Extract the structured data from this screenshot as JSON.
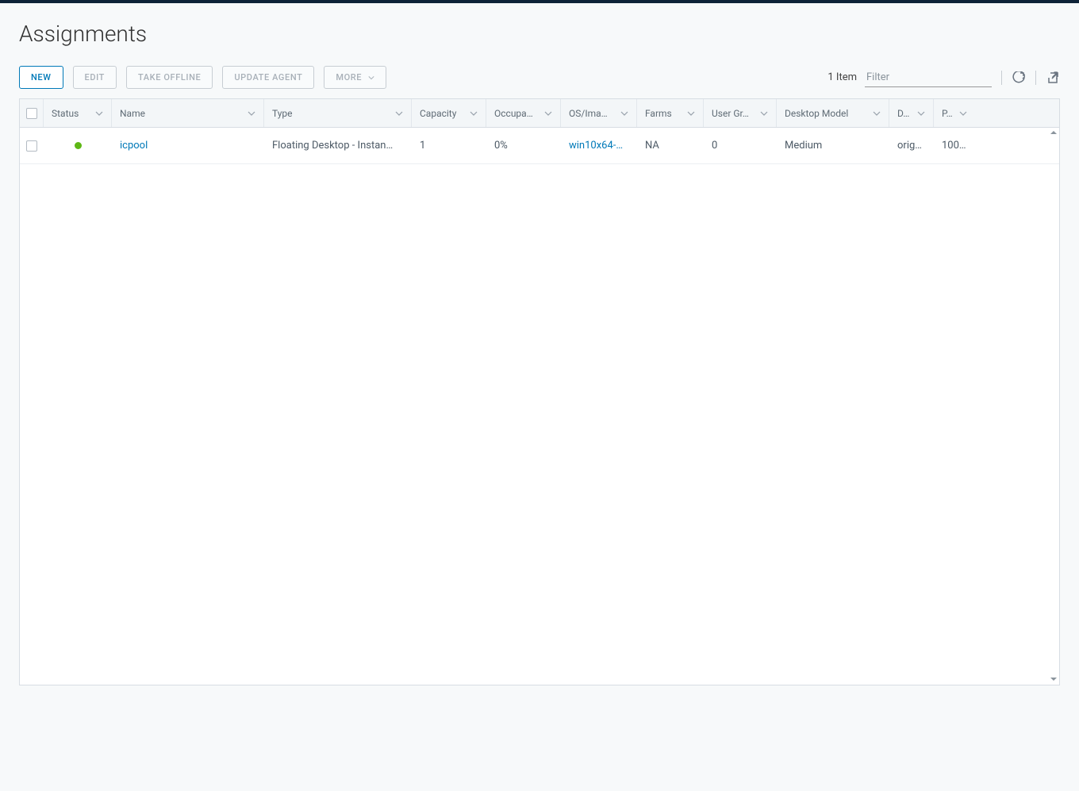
{
  "page": {
    "title": "Assignments"
  },
  "toolbar": {
    "new": "New",
    "edit": "Edit",
    "take_offline": "Take Offline",
    "update_agent": "Update Agent",
    "more": "More",
    "item_count": "1 Item",
    "filter_placeholder": "Filter"
  },
  "columns": {
    "status": "Status",
    "name": "Name",
    "type": "Type",
    "capacity": "Capacity",
    "occupancy": "Occupa…",
    "osimage": "OS/Ima…",
    "farms": "Farms",
    "usergroups": "User Gr…",
    "desktopmodel": "Desktop Model",
    "d": "D…",
    "p": "P…"
  },
  "rows": [
    {
      "status": "green",
      "name": "icpool",
      "type": "Floating Desktop - Instan…",
      "capacity": "1",
      "occupancy": "0%",
      "osimage": "win10x64-…",
      "farms": "NA",
      "usergroups": "0",
      "desktopmodel": "Medium",
      "d": "orig…",
      "p": "100…"
    }
  ]
}
